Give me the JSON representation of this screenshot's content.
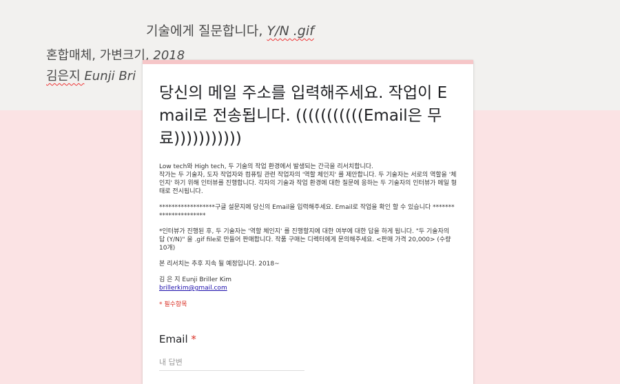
{
  "background": {
    "artwork_title": "기술에게 질문합니다, ",
    "artwork_title_italic": "Y/N .gif",
    "medium": "혼합매체, 가변크기, ",
    "year": "2018",
    "artist_ko": "김은지 ",
    "artist_en": "Eunji Bri"
  },
  "form": {
    "title": "당신의 메일 주소를 입력해주세요. 작업이 Email로 전송됩니다. (((((((((((Email은 무료)))))))))))",
    "description": [
      "Low tech와 High tech, 두 기술의 작업 환경에서 발생되는 간극을 리서치합니다.\n작가는 두 기술자, 도자 작업자와 컴퓨팅 관련 작업자의 '역할 체인지' 를 제안합니다. 두 기술자는 서로의 역할을 '체인지' 하기 위해 인터뷰를 진행합니다. 각자의 기술과 작업 환경에 대한 질문에 응하는 두 기술자의 인터뷰가 메일 형태로 전시됩니다.",
      "******************구글 설문지에 당신의 Email을 입력해주세요. Email로 작업을 확인 할 수 있습니다 **********************",
      "*인터뷰가 진행된 후, 두 기술자는 '역할 체인지' 를 진행할지에 대한 여부에 대한 답을 하게 됩니다. \"두 기술자의 답 (Y/N)\" 을 .gif file로 만들어 판매합니다. 작품 구매는 디렉터에게 문의해주세요. <판매 가격 20,000> (수량 10개)",
      "본 리서치는 추후 지속 될 예정입니다. 2018~"
    ],
    "author_name": "김 은 지 Eunji Briller Kim",
    "author_email": "brillerkim@gmail.com",
    "required_note": "* 필수항목",
    "question_label": "Email",
    "question_required_mark": "*",
    "answer_placeholder": "내 답변"
  }
}
